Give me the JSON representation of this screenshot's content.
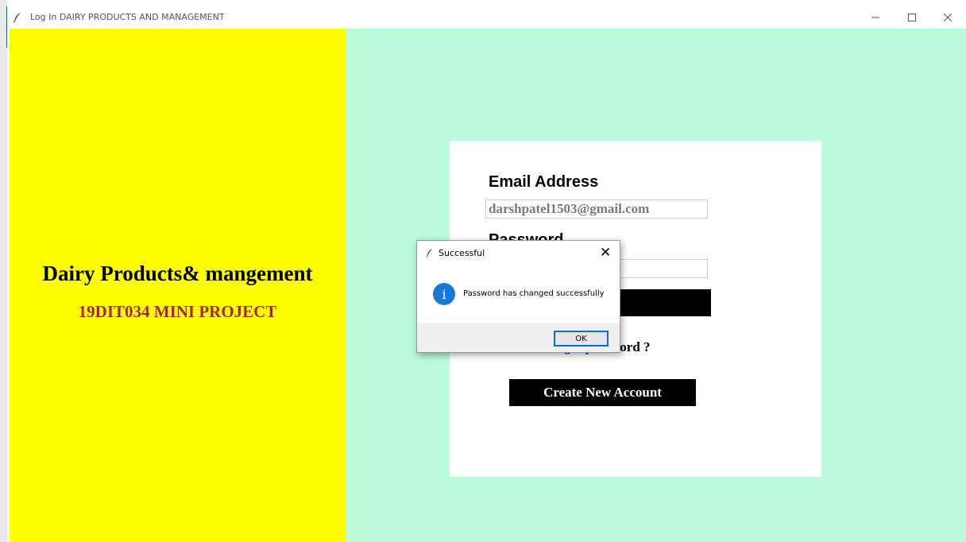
{
  "window": {
    "title": "Log In DAIRY PRODUCTS AND MANAGEMENT",
    "minimize_icon": "minimize-icon",
    "maximize_icon": "maximize-icon",
    "close_icon": "close-icon"
  },
  "left_panel": {
    "title": "Dairy Products& mangement",
    "subtitle": "19DIT034 MINI PROJECT",
    "background": "#ffff00",
    "subtitle_color": "#a52a2a"
  },
  "login_form": {
    "email_label": "Email Address",
    "email_value": "darshpatel1503@gmail.com",
    "password_label": "Password",
    "password_value": "",
    "forgot_label": "Forgot password ?",
    "create_account_label": "Create New Account",
    "background": "#bbfad9"
  },
  "dialog": {
    "title": "Successful",
    "message": "Password has changed successfully",
    "ok_label": "OK",
    "icon": "info-icon",
    "close_label": "✕"
  }
}
